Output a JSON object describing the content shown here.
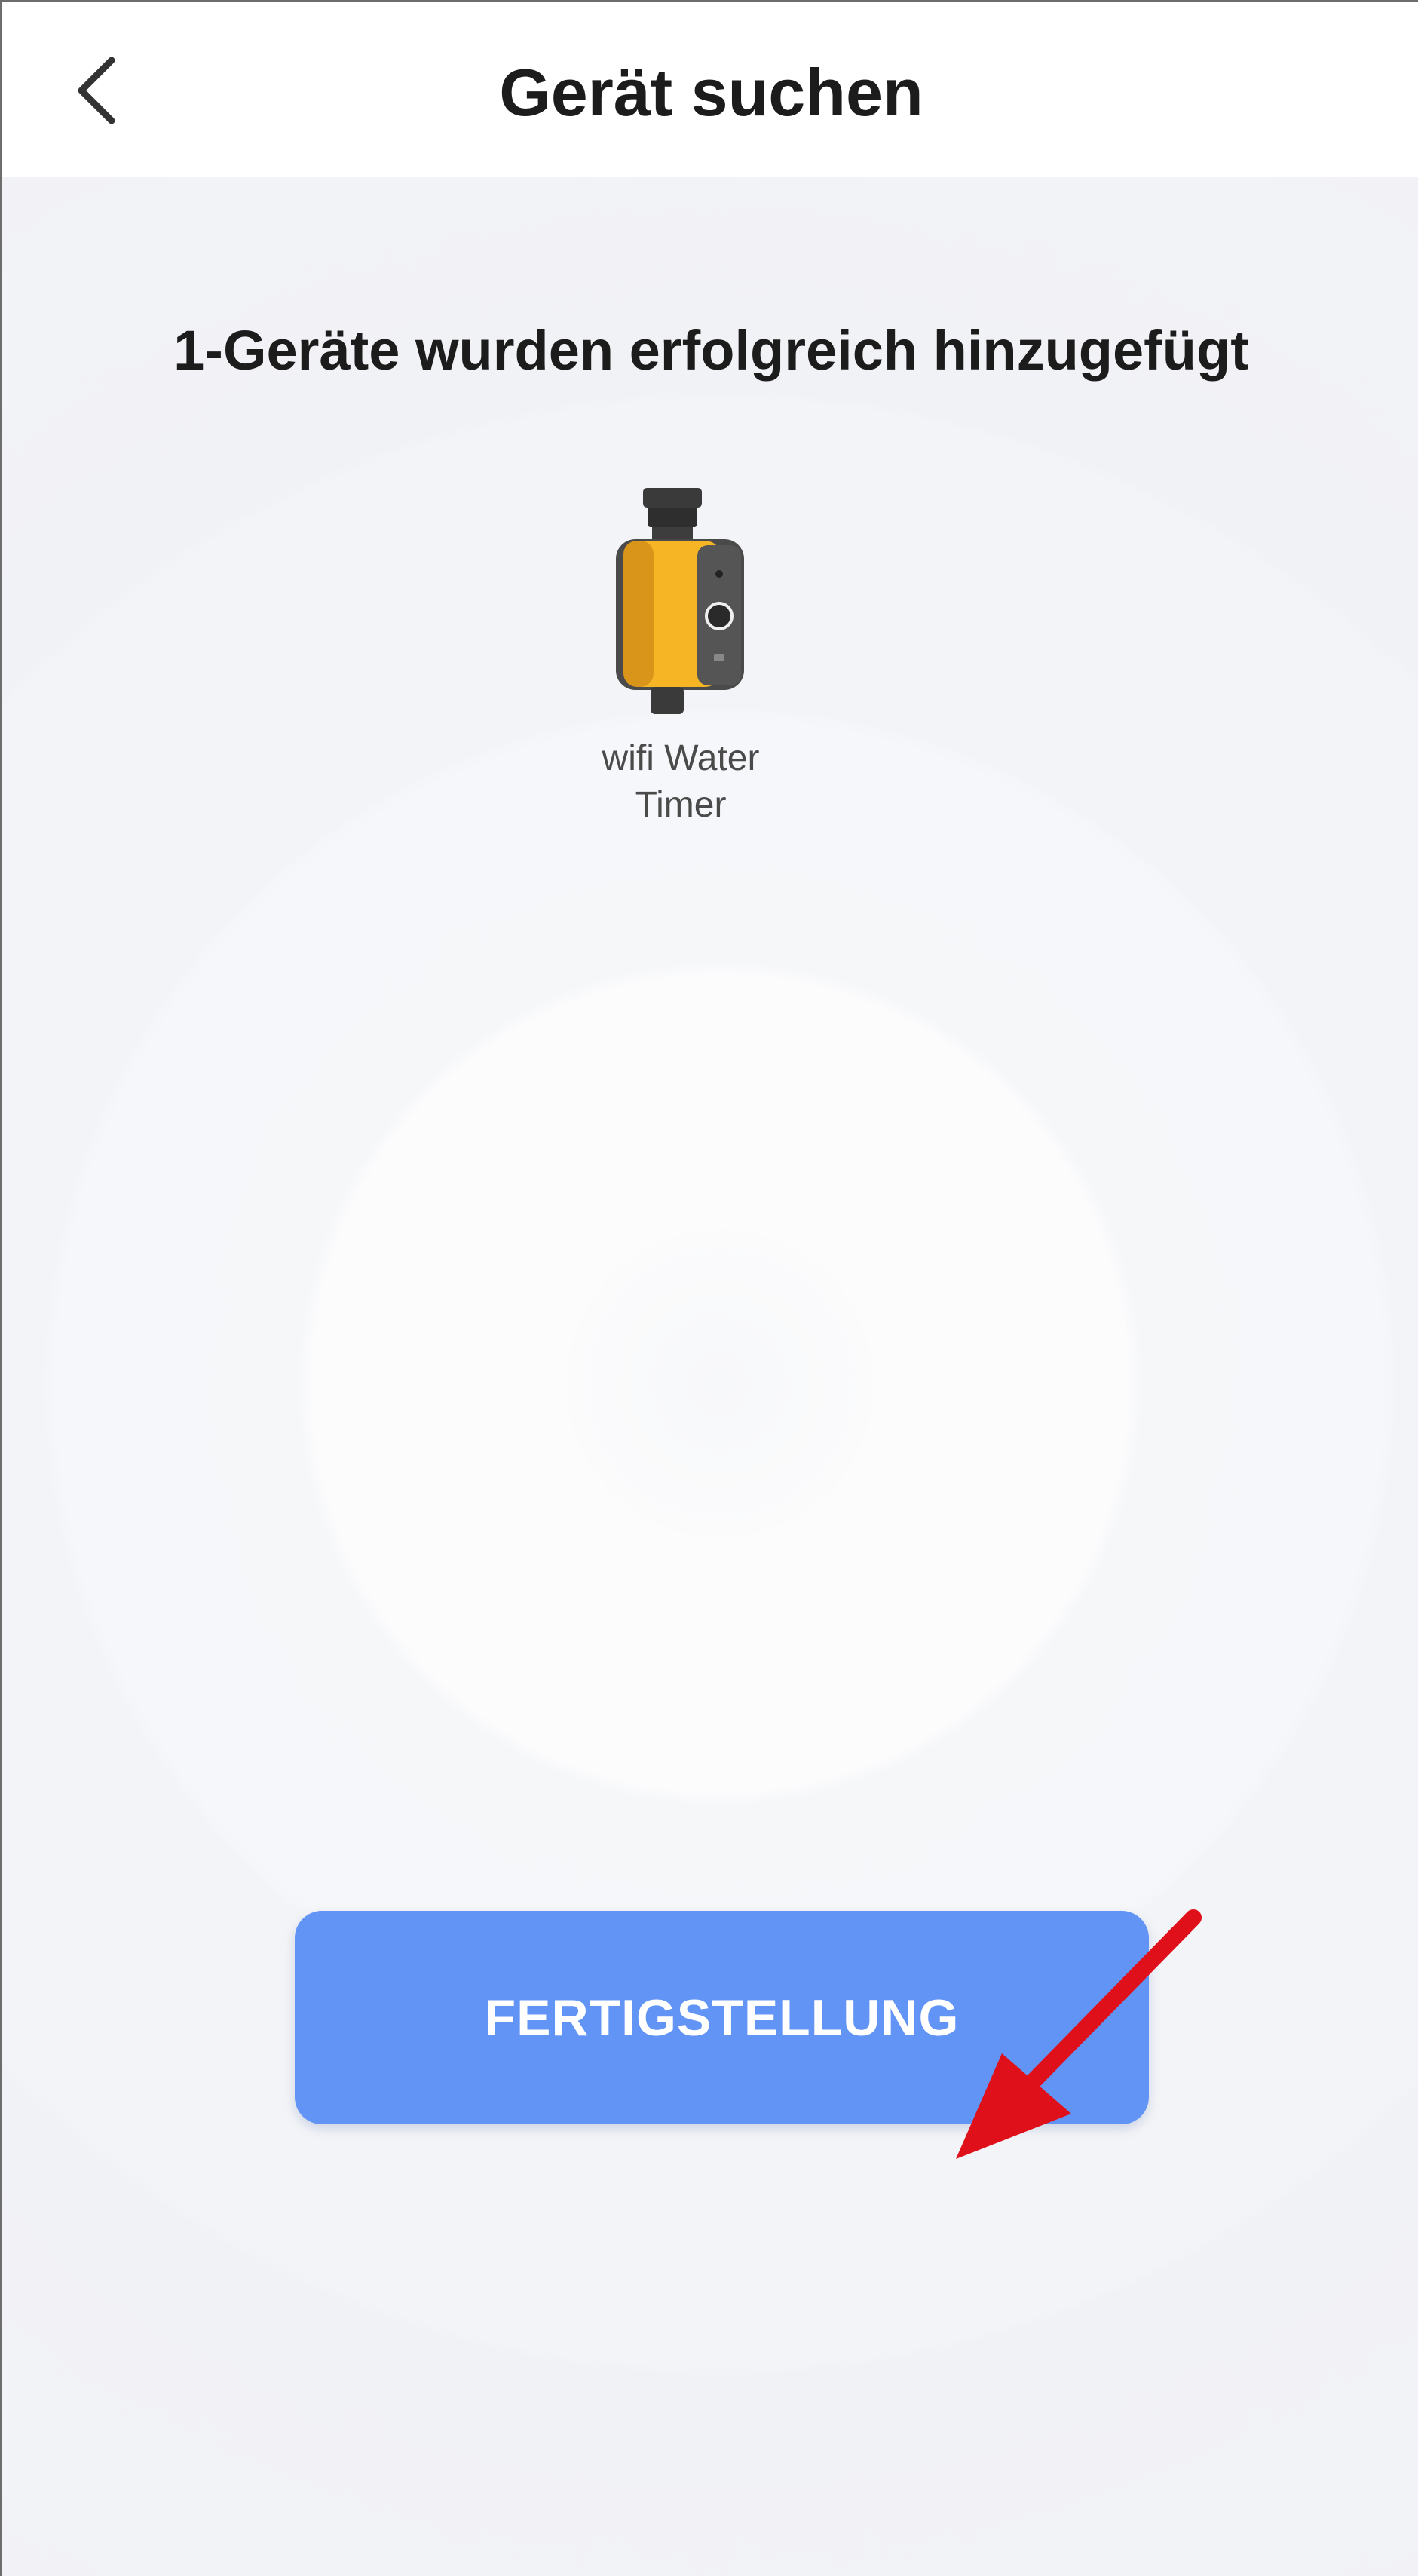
{
  "header": {
    "title": "Gerät suchen",
    "back_icon": "chevron-left-icon"
  },
  "main": {
    "heading": "1-Geräte wurden erfolgreich hinzugefügt",
    "devices": [
      {
        "name_line1": "wifi Water",
        "name_line2": "Timer",
        "image": "water-timer-device"
      }
    ],
    "finish_button_label": "FERTIGSTELLUNG"
  },
  "colors": {
    "button": "#6194f5",
    "annotation_arrow": "#e0101a",
    "device_body": "#f5b524"
  }
}
